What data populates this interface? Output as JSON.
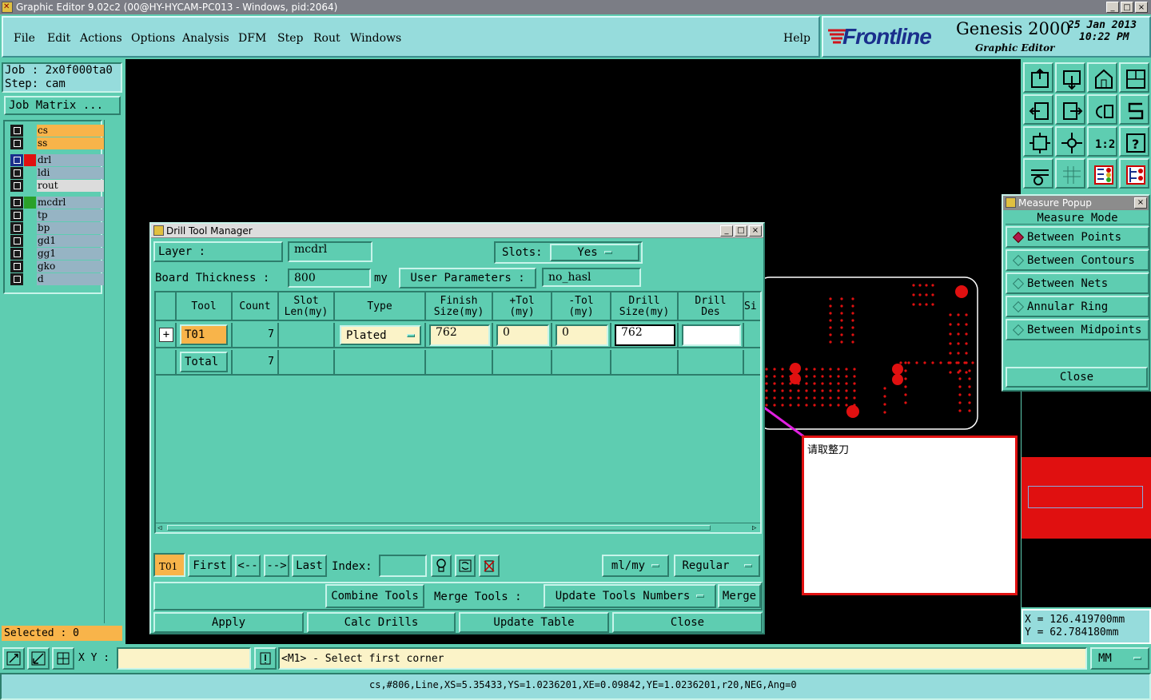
{
  "window": {
    "title": "Graphic Editor 9.02c2 (00@HY-HYCAM-PC013 - Windows, pid:2064)",
    "min": "_",
    "max": "□",
    "close": "×"
  },
  "menu": {
    "items": [
      "File",
      "Edit",
      "Actions",
      "Options",
      "Analysis",
      "DFM",
      "Step",
      "Rout",
      "Windows"
    ],
    "help": "Help"
  },
  "brand": {
    "logo": "Frontline",
    "product": "Genesis 2000",
    "subtitle": "Graphic Editor",
    "date": "25 Jan 2013",
    "time": "10:22 PM"
  },
  "job": {
    "job_label": "Job : 2x0f000ta0",
    "step_label": "Step: cam",
    "matrix_button": "Job Matrix ..."
  },
  "layers": [
    {
      "name": "cs",
      "color": "#f8b44a",
      "swatch": ""
    },
    {
      "name": "ss",
      "color": "#f8b44a",
      "swatch": ""
    },
    {
      "name": "drl",
      "color": "#96b4c4",
      "swatch": "#e01010"
    },
    {
      "name": "ldi",
      "color": "#96b4c4",
      "swatch": ""
    },
    {
      "name": "rout",
      "color": "#dcdcdc",
      "swatch": ""
    },
    {
      "name": "mcdrl",
      "color": "#96b4c4",
      "swatch": "#2aa02a"
    },
    {
      "name": "tp",
      "color": "#96b4c4",
      "swatch": ""
    },
    {
      "name": "bp",
      "color": "#96b4c4",
      "swatch": ""
    },
    {
      "name": "gd1",
      "color": "#96b4c4",
      "swatch": ""
    },
    {
      "name": "gg1",
      "color": "#96b4c4",
      "swatch": ""
    },
    {
      "name": "gko",
      "color": "#96b4c4",
      "swatch": ""
    },
    {
      "name": "d",
      "color": "#96b4c4",
      "swatch": ""
    }
  ],
  "selected": "Selected : 0",
  "dtm": {
    "title": "Drill Tool Manager",
    "layer_label": "Layer          :",
    "layer_value": "mcdrl",
    "slots_label": "Slots:",
    "slots_value": "Yes",
    "board_thickness_label": "Board Thickness :",
    "board_thickness_value": "800",
    "board_thickness_unit": "my",
    "user_params_label": "User Parameters :",
    "user_params_value": "no_hasl",
    "columns": [
      "Tool",
      "Count",
      "Slot Len(my)",
      "Type",
      "Finish Size(my)",
      "+Tol (my)",
      "-Tol (my)",
      "Drill Size(my)",
      "Drill Des",
      "Si"
    ],
    "rows": [
      {
        "tool": "T01",
        "count": "7",
        "type": "Plated",
        "finish": "762",
        "plus_tol": "0",
        "minus_tol": "0",
        "drill": "762",
        "drill_des": ""
      }
    ],
    "total": {
      "label": "Total",
      "count": "7"
    },
    "nav": {
      "current": "T01",
      "first": "First",
      "prev": "<--",
      "next": "-->",
      "last": "Last",
      "index_label": "Index:",
      "units": "ml/my",
      "mode": "Regular"
    },
    "combine_tools": "Combine Tools",
    "merge_tools_label": "Merge Tools :",
    "update_numbers": "Update Tools Numbers",
    "merge": "Merge",
    "apply": "Apply",
    "calc_drills": "Calc Drills",
    "update_table": "Update Table",
    "close": "Close"
  },
  "annotation": {
    "text": "请取整刀",
    "arrow_color": "#e020e0",
    "box_color": "#e01010"
  },
  "measure": {
    "title": "Measure Popup",
    "mode_label": "Measure Mode",
    "modes": [
      {
        "label": "Between Points",
        "selected": true
      },
      {
        "label": "Between Contours",
        "selected": false
      },
      {
        "label": "Between Nets",
        "selected": false
      },
      {
        "label": "Annular Ring",
        "selected": false
      },
      {
        "label": "Between Midpoints",
        "selected": false
      }
    ],
    "close": "Close"
  },
  "toolbar_icons": [
    "home-up-icon",
    "home-down-icon",
    "home-icon",
    "panel-icon",
    "step-back-icon",
    "step-forward-icon",
    "undo-icon",
    "snake-icon",
    "zoom-fit-icon",
    "zoom-center-icon",
    "scale-icon",
    "help-icon",
    "tools-icon",
    "grid-icon",
    "layers-a-icon",
    "layers-b-icon"
  ],
  "coords": {
    "x": "X  =  126.419700mm",
    "y": "Y  =  62.784180mm"
  },
  "status": {
    "xy_label": "X Y :",
    "xy_value": "",
    "prompt": "<M1> - Select first corner",
    "units": "MM",
    "feature": "cs,#806,Line,XS=5.35433,YS=1.0236201,XE=0.09842,YE=1.0236201,r20,NEG,Ang=0"
  }
}
